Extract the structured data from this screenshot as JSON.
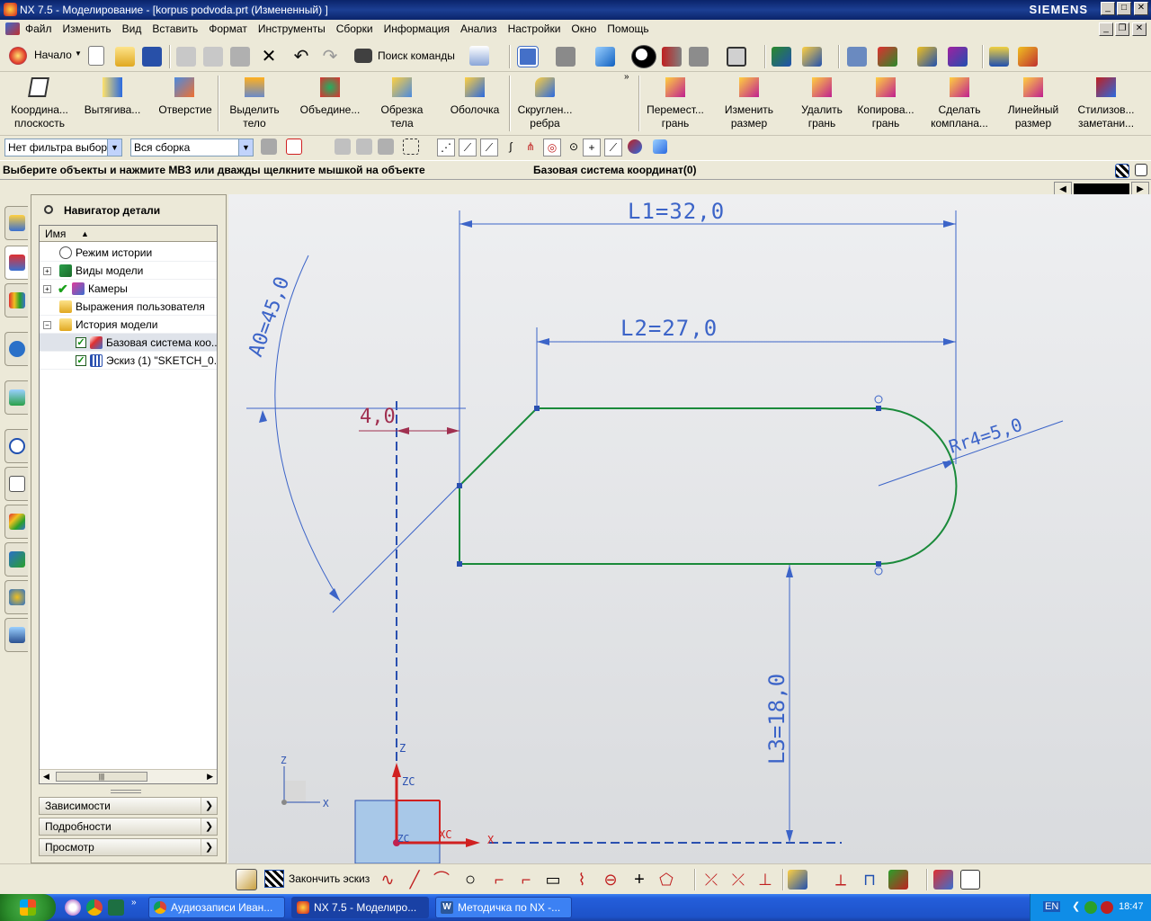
{
  "window": {
    "title": "NX 7.5 - Моделирование - [korpus podvoda.prt (Измененный) ]",
    "brand": "SIEMENS"
  },
  "menu": [
    "Файл",
    "Изменить",
    "Вид",
    "Вставить",
    "Формат",
    "Инструменты",
    "Сборки",
    "Информация",
    "Анализ",
    "Настройки",
    "Окно",
    "Помощь"
  ],
  "standard_toolbar": {
    "start_label": "Начало",
    "search_label": "Поиск команды"
  },
  "feature_toolbar": [
    {
      "label": "Координа... плоскость"
    },
    {
      "label": "Вытягива..."
    },
    {
      "label": "Отверстие"
    },
    {
      "label": "Выделить тело"
    },
    {
      "label": "Объедине..."
    },
    {
      "label": "Обрезка тела"
    },
    {
      "label": "Оболочка"
    },
    {
      "label": "Скруглен... ребра"
    }
  ],
  "sync_toolbar": [
    {
      "label": "Перемест... грань"
    },
    {
      "label": "Изменить размер"
    },
    {
      "label": "Удалить грань"
    },
    {
      "label": "Копирова... грань"
    },
    {
      "label": "Сделать компланa..."
    },
    {
      "label": "Линейный размер"
    },
    {
      "label": "Стилизов... заметани..."
    }
  ],
  "selection_bar": {
    "filter": "Нет фильтра выбор",
    "scope": "Вся сборка"
  },
  "cue_line": "Выберите объекты и нажмите МВ3 или дважды щелкните мышкой на объекте",
  "status_line": "Базовая система координат(0)",
  "navigator": {
    "title": "Навигатор детали",
    "column": "Имя",
    "rows": [
      {
        "label": "Режим истории"
      },
      {
        "label": "Виды модели"
      },
      {
        "label": "Камеры"
      },
      {
        "label": "Выражения пользователя"
      },
      {
        "label": "История модели"
      },
      {
        "label": "Базовая система коо..."
      },
      {
        "label": "Эскиз (1) \"SKETCH_0..."
      }
    ],
    "panels": [
      "Зависимости",
      "Подробности",
      "Просмотр"
    ]
  },
  "sketch": {
    "dimensions": {
      "L1": "L1=32,0",
      "L2": "L2=27,0",
      "L3": "L3=18,0",
      "A0": "A0=45,0",
      "R": "Rr4=5,0",
      "offset": "4,0"
    },
    "axes": {
      "z": "Z",
      "zc": "ZC",
      "xc": "XC",
      "x": "X",
      "zc2": "ZC"
    },
    "triad": {
      "z": "Z",
      "x": "X"
    }
  },
  "sketch_toolbar": {
    "finish_label": "Закончить эскиз"
  },
  "taskbar": {
    "tasks": [
      "Аудиозаписи Иван...",
      "NX 7.5 - Моделиро...",
      "Методичка по NX -..."
    ],
    "lang": "EN",
    "clock": "18:47"
  },
  "colors": {
    "sketch_curve": "#1a8a3a",
    "dimension": "#3c64c8",
    "constraint": "#a03050",
    "axis_red": "#d02020"
  }
}
